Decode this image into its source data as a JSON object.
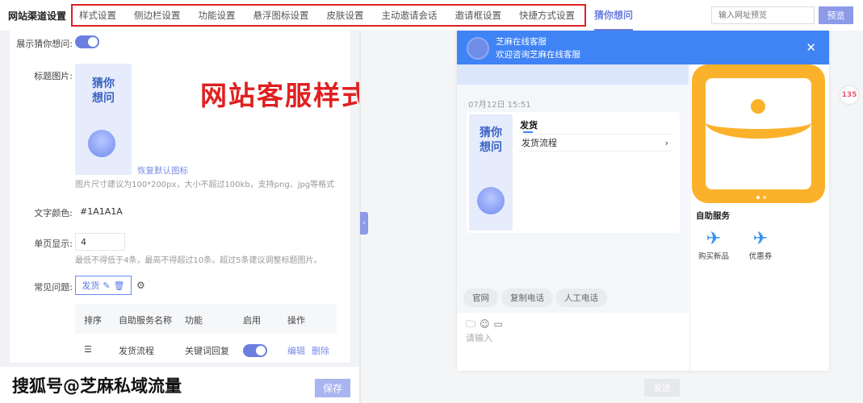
{
  "topbar": {
    "brand": "网站渠道设置",
    "tabs": [
      "样式设置",
      "侧边栏设置",
      "功能设置",
      "悬浮图标设置",
      "皮肤设置",
      "主动邀请会话",
      "邀请框设置",
      "快捷方式设置"
    ],
    "active_tab": "猜你想问",
    "url_placeholder": "输入网址预览",
    "preview_label": "预览"
  },
  "overlay_title": "网站客服样式设置",
  "form": {
    "show_guess_label": "展示猜你想问:",
    "show_guess_on": true,
    "title_image_label": "标题图片:",
    "thumb_text_1": "猜你",
    "thumb_text_2": "想问",
    "restore_default": "恢复默认图标",
    "image_hint": "图片尺寸建议为100*200px，大小不超过100kb，支持png、jpg等格式",
    "text_color_label": "文字颜色:",
    "text_color_value": "#1A1A1A",
    "text_color": "#1A1A1A",
    "per_page_label": "单页显示:",
    "per_page_value": "4",
    "per_page_hint": "最低不得低于4条，最高不得超过10条。超过5条建议调整标题图片。",
    "faq_label": "常见问题:",
    "faq_tag": "发货",
    "table": {
      "headers": [
        "排序",
        "自助服务名称",
        "功能",
        "启用",
        "操作"
      ],
      "rows": [
        {
          "name": "发货流程",
          "function": "关键词回复",
          "enabled": true,
          "edit": "编辑",
          "delete": "删除"
        }
      ]
    },
    "save_label": "保存"
  },
  "watermark": "搜狐号@芝麻私域流量",
  "chat": {
    "title": "芝麻在线客服",
    "subtitle": "欢迎咨询芝麻在线客服",
    "time": "07月12日 15:51",
    "card_title": "发货",
    "card_item": "发货流程",
    "chips": [
      "官网",
      "复制电话",
      "人工电话"
    ],
    "input_placeholder": "请输入",
    "send_label": "发送",
    "side_title": "自助服务",
    "services": [
      "购买新品",
      "优惠券"
    ],
    "accent": "#3F83F5",
    "banner_color": "#FBB22A"
  },
  "float_icon_text": "135"
}
